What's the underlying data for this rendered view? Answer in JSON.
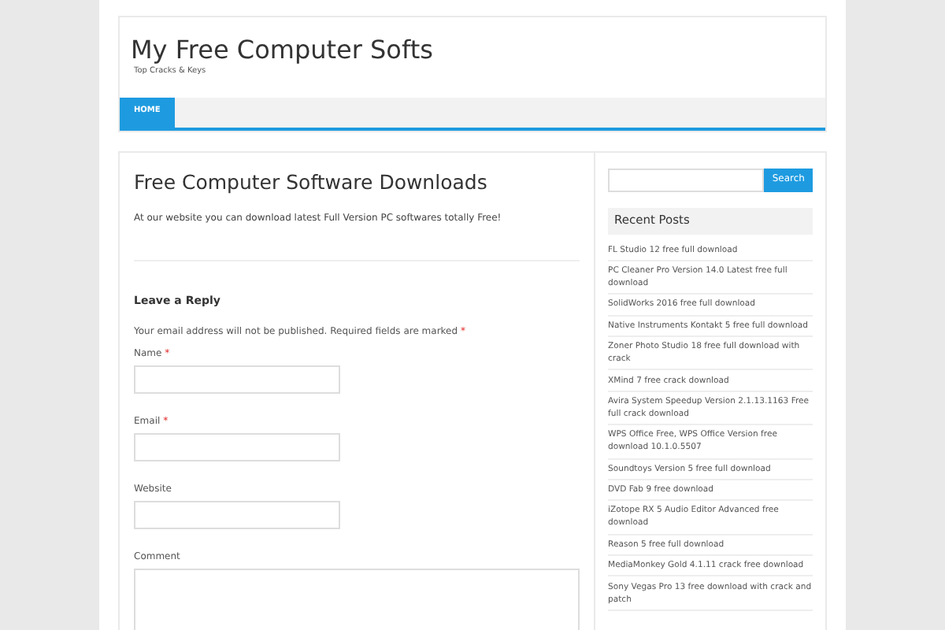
{
  "site": {
    "title": "My Free Computer Softs",
    "tagline": "Top Cracks & Keys"
  },
  "nav": [
    {
      "label": "HOME",
      "selected": true
    }
  ],
  "page": {
    "title": "Free Computer Software Downloads",
    "intro": "At our website you can download latest Full Version PC softwares totally Free!"
  },
  "reply": {
    "heading": "Leave a Reply",
    "notice": "Your email address will not be published. Required fields are marked",
    "notice_mark": "*",
    "fields": [
      {
        "kind": "input",
        "label": "Name",
        "mark": "*"
      },
      {
        "kind": "input",
        "label": "Email",
        "mark": "*"
      },
      {
        "kind": "input",
        "label": "Website"
      },
      {
        "kind": "textarea",
        "label": "Comment"
      }
    ]
  },
  "sidebar": {
    "search_button": "Search",
    "recent_title": "Recent Posts",
    "posts": [
      "FL Studio 12 free full download",
      "PC Cleaner Pro Version 14.0 Latest free full download",
      "SolidWorks 2016 free full download",
      "Native Instruments Kontakt 5 free full download",
      "Zoner Photo Studio 18 free full download with crack",
      "XMind 7 free crack download",
      "Avira System Speedup Version 2.1.13.1163 Free full crack download",
      "WPS Office Free, WPS Office Version free download 10.1.0.5507",
      "Soundtoys Version 5 free full download",
      "DVD Fab 9 free download",
      "iZotope RX 5 Audio Editor Advanced free download",
      "Reason 5 free full download",
      "MediaMonkey Gold 4.1.11 crack free download",
      "Sony Vegas Pro 13 free download with crack and patch"
    ]
  }
}
